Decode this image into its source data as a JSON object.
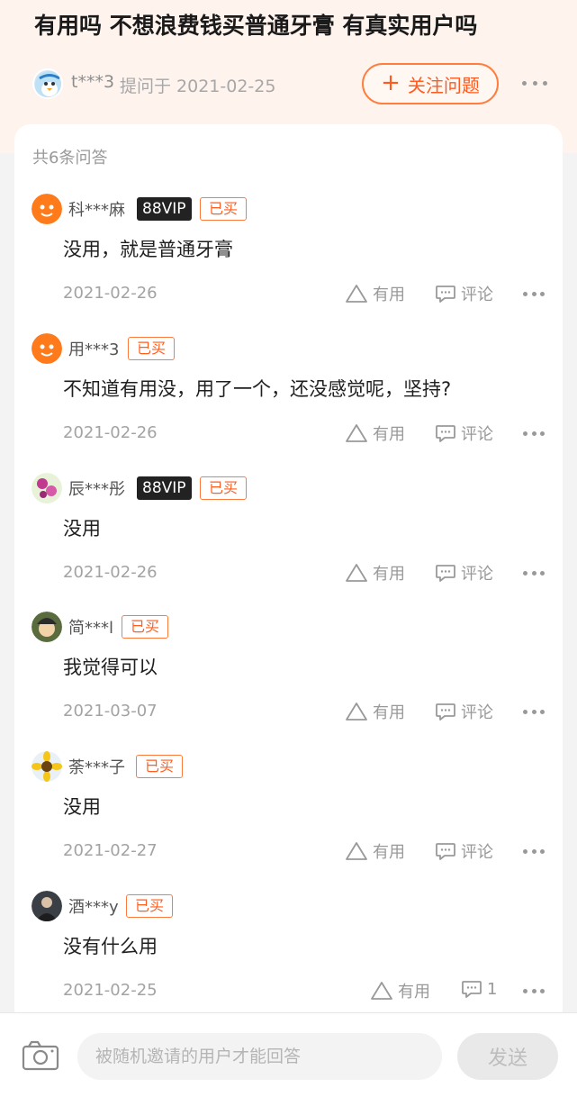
{
  "question": {
    "title": "有用吗 不想浪费钱买普通牙膏 有真实用户吗",
    "asker": "t***3",
    "asked_on": "提问于 2021-02-25",
    "follow_label": "关注问题",
    "follow_icon": "plus-icon"
  },
  "answers_header": "共6条问答",
  "answers": [
    {
      "user": "科***麻",
      "vip": "88VIP",
      "bought": "已买",
      "content": "没用，就是普通牙膏",
      "date": "2021-02-26",
      "useful": "有用",
      "comment": "评论"
    },
    {
      "user": "用***3",
      "vip": "",
      "bought": "已买",
      "content": "不知道有用没，用了一个，还没感觉呢，坚持?",
      "date": "2021-02-26",
      "useful": "有用",
      "comment": "评论"
    },
    {
      "user": "辰***彤",
      "vip": "88VIP",
      "bought": "已买",
      "content": "没用",
      "date": "2021-02-26",
      "useful": "有用",
      "comment": "评论"
    },
    {
      "user": "简***l",
      "vip": "",
      "bought": "已买",
      "content": "我觉得可以",
      "date": "2021-03-07",
      "useful": "有用",
      "comment": "评论"
    },
    {
      "user": "荼***子",
      "vip": "",
      "bought": "已买",
      "content": "没用",
      "date": "2021-02-27",
      "useful": "有用",
      "comment": "评论"
    },
    {
      "user": "酒***y",
      "vip": "",
      "bought": "已买",
      "content": "没有什么用",
      "date": "2021-02-25",
      "useful": "有用",
      "comment": "1"
    }
  ],
  "reply": {
    "placeholder": "被随机邀请的用户才能回答",
    "send_label": "发送"
  },
  "colors": {
    "accent": "#ff5a1f",
    "header_bg": "#fff3ee",
    "vip_bg": "#222222"
  }
}
